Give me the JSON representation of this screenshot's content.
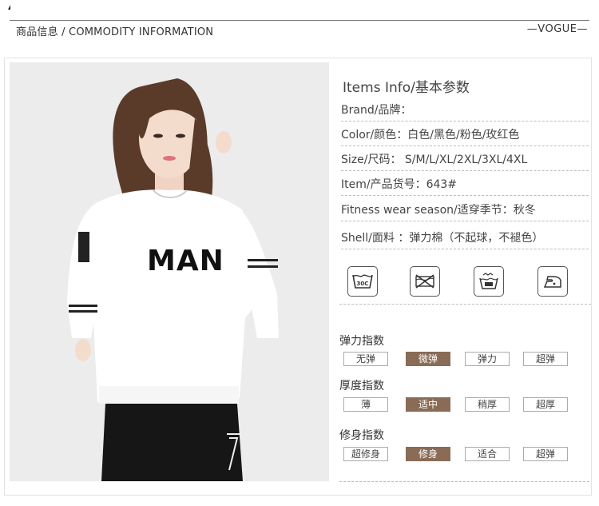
{
  "header": {
    "title": "商品信息 / COMMODITY INFORMATION",
    "tag": "—VOGUE—"
  },
  "product_photo": {
    "print_text": "MAN"
  },
  "info": {
    "section_title": "Items Info/基本参数",
    "rows": [
      "Brand/品牌：",
      "Color/颜色：白色/黑色/粉色/玫红色",
      "Size/尺码： S/M/L/XL/2XL/3XL/4XL",
      "Item/产品货号：643#",
      "Fitness wear season/适穿季节：秋冬",
      "Shell/面料 ：弹力棉（不起球，不褪色）"
    ],
    "care_icons": [
      "wash-30c-icon",
      "do-not-tumble-dry-icon",
      "hand-wash-icon",
      "iron-icon"
    ],
    "wash_temp_label": "30C"
  },
  "indices": [
    {
      "title": "弹力指数",
      "options": [
        "无弹",
        "微弹",
        "弹力",
        "超弹"
      ],
      "selected": 1
    },
    {
      "title": "厚度指数",
      "options": [
        "薄",
        "适中",
        "稍厚",
        "超厚"
      ],
      "selected": 1
    },
    {
      "title": "修身指数",
      "options": [
        "超修身",
        "修身",
        "适合",
        "超弹"
      ],
      "selected": 1
    }
  ],
  "colors": {
    "selected_option": "#8a6b55",
    "photo_background": "#ededed"
  }
}
